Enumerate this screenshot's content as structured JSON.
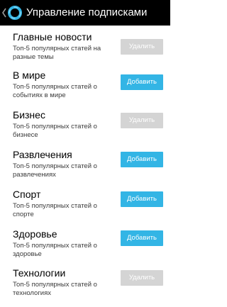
{
  "header": {
    "title": "Управление подписками",
    "back_icon": "back-arrow-icon",
    "app_icon": "ring-logo-icon",
    "background_color": "#000000"
  },
  "accent_colors": {
    "add_button": "#33b5e5",
    "remove_button": "#d4d4d4"
  },
  "items": [
    {
      "title": "Главные новости",
      "description": "Топ-5 популярных статей на разные темы",
      "button_label": "Удалить",
      "button_state": "remove"
    },
    {
      "title": "В мире",
      "description": "Топ-5 популярных статей о событиях в мире",
      "button_label": "Добавить",
      "button_state": "add"
    },
    {
      "title": "Бизнес",
      "description": "Топ-5 популярных статей о бизнесе",
      "button_label": "Удалить",
      "button_state": "remove"
    },
    {
      "title": "Развлечения",
      "description": "Топ-5 популярных статей о развлечениях",
      "button_label": "Добавить",
      "button_state": "add"
    },
    {
      "title": "Спорт",
      "description": "Топ-5 популярных статей о спорте",
      "button_label": "Добавить",
      "button_state": "add"
    },
    {
      "title": "Здоровье",
      "description": "Топ-5 популярных статей о здоровье",
      "button_label": "Добавить",
      "button_state": "add"
    },
    {
      "title": "Технологии",
      "description": "Топ-5 популярных статей о технологиях",
      "button_label": "Удалить",
      "button_state": "remove"
    }
  ]
}
